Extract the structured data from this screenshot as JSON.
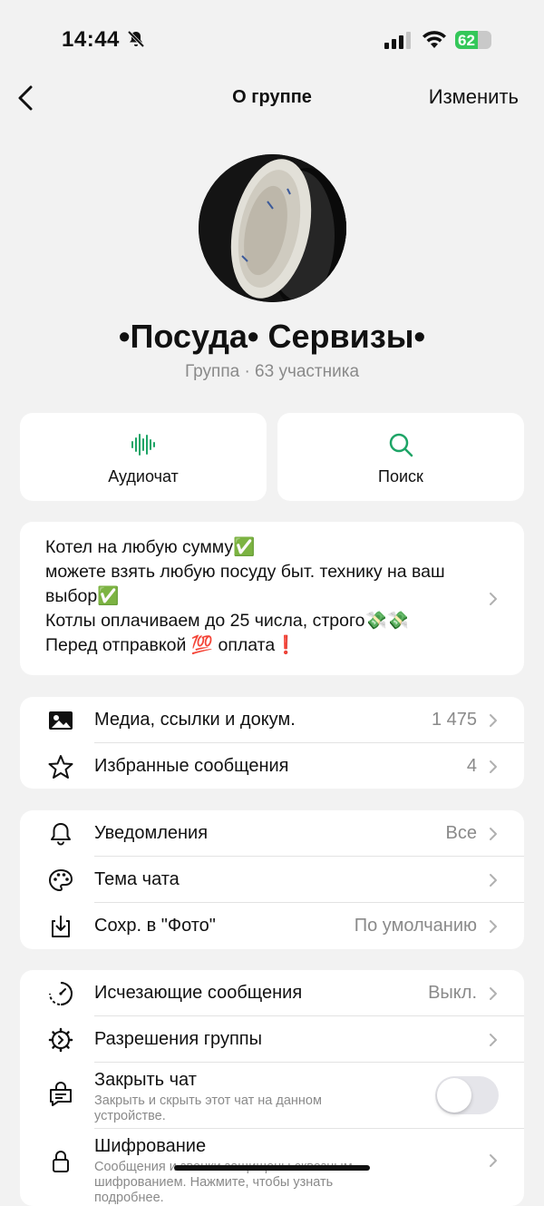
{
  "status_bar": {
    "time": "14:44",
    "battery": "62",
    "battery_fraction": 0.62
  },
  "nav": {
    "title": "О группе",
    "edit_label": "Изменить"
  },
  "group": {
    "name": "•Посуда• Сервизы•",
    "subtitle": "Группа · 63 участника"
  },
  "actions": {
    "audiochat_label": "Аудиочат",
    "search_label": "Поиск"
  },
  "description": {
    "lines": [
      "Котел на любую сумму✅",
      "можете взять любую посуду быт. технику на ваш выбор✅",
      "Котлы оплачиваем до 25 числа, строго💸💸",
      "Перед отправкой 💯 оплата❗️"
    ]
  },
  "section_media": {
    "media": {
      "label": "Медиа, ссылки и докум.",
      "value": "1 475"
    },
    "starred": {
      "label": "Избранные сообщения",
      "value": "4"
    }
  },
  "section_settings": {
    "notifications": {
      "label": "Уведомления",
      "value": "Все"
    },
    "theme": {
      "label": "Тема чата"
    },
    "save_photos": {
      "label": "Сохр. в \"Фото\"",
      "value": "По умолчанию"
    }
  },
  "section_privacy": {
    "disappearing": {
      "label": "Исчезающие сообщения",
      "value": "Выкл."
    },
    "permissions": {
      "label": "Разрешения группы"
    },
    "lock_chat": {
      "label": "Закрыть чат",
      "sublabel": "Закрыть и скрыть этот чат на данном устройстве.",
      "enabled": false
    },
    "encryption": {
      "label": "Шифрование",
      "sublabel": "Сообщения и звонки защищены сквозным шифрованием. Нажмите, чтобы узнать подробнее."
    }
  },
  "colors": {
    "accent": "#1da466",
    "background": "#f2f2f2",
    "card": "#ffffff",
    "secondary_text": "#8a8a8a"
  },
  "icons": {
    "back": "chevron-left-icon",
    "mute": "bell-slash-icon",
    "audio": "waveform-icon",
    "search": "magnifier-icon",
    "media": "photo-icon",
    "star": "star-icon",
    "bell": "bell-icon",
    "palette": "palette-icon",
    "download": "download-icon",
    "timer": "timer-icon",
    "gear": "gear-icon",
    "lock_chat": "lock-chat-icon",
    "lock": "lock-icon"
  }
}
